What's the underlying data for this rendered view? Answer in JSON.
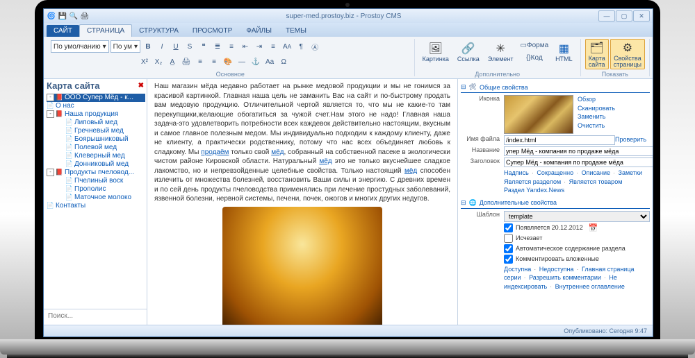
{
  "window": {
    "title": "super-med.prostoy.biz - Prostoy CMS",
    "min": "—",
    "max": "▢",
    "close": "✕"
  },
  "tabs": {
    "site": "САЙТ",
    "page": "СТРАНИЦА",
    "structure": "СТРУКТУРА",
    "view": "ПРОСМОТР",
    "files": "ФАЙЛЫ",
    "themes": "ТЕМЫ"
  },
  "ribbon": {
    "style_combo": "По умолчанию",
    "format_combo": "По ум",
    "group_main": "Основное",
    "group_extra": "Дополнительно",
    "group_show": "Показать",
    "picture": "Картинка",
    "link": "Ссылка",
    "element": "Элемент",
    "form": "Форма",
    "code": "Код",
    "html": "HTML",
    "sitemap": "Карта\nсайта",
    "pageprops": "Свойства\nстраницы"
  },
  "sidebar": {
    "title": "Карта сайта",
    "search_placeholder": "Поиск...",
    "items": [
      {
        "label": "ООО Супер Мёд - к...",
        "sel": true,
        "exp": "-",
        "icon": "📕"
      },
      {
        "label": "О нас",
        "icon": "📄"
      },
      {
        "label": "Наша продукция",
        "exp": "-",
        "icon": "📕",
        "children": [
          {
            "label": "Липовый мед"
          },
          {
            "label": "Гречневый мед"
          },
          {
            "label": "Боярышниковый"
          },
          {
            "label": "Полевой мед"
          },
          {
            "label": "Клеверный мед"
          },
          {
            "label": "Донниковый мед"
          }
        ]
      },
      {
        "label": "Продукты пчеловод...",
        "exp": "-",
        "icon": "📕",
        "children": [
          {
            "label": "Пчелиный воск"
          },
          {
            "label": "Прополис"
          },
          {
            "label": "Маточное молоко"
          }
        ]
      },
      {
        "label": "Контакты",
        "icon": "📄"
      }
    ]
  },
  "content": {
    "p1_a": "Наш магазин мёда недавно работает на рынке медовой продукции и мы не гонимся за красивой картинкой. Главная наша цель не заманить Вас на сайт и по-быстрому продать вам медовую продукцию. Отличительной чертой является то, что мы не какие-то там перекупщики,желающие обогатиться за чужой счет.Нам этого не надо! Главная наша задача-это удовлетворить потребности всех каждевок действительно настоящим, вкусным и самое главное полезным медом. Мы индивидуально подходим к каждому клиенту, даже не клиенту, а практически родственнику, потому что нас всех объединяет любовь к сладкому. Мы ",
    "p1_link1": "продаём",
    "p1_b": " только свой ",
    "p1_link2": "мёд",
    "p1_c": ", собранный на собственной пасеке в экологически чистом районе Кировской области. Натуральный ",
    "p1_link3": "мёд",
    "p1_d": " это не только вкуснейшее сладкое лакомство, но и непревзойденные целебные свойства. Только настоящий ",
    "p1_link4": "мёд",
    "p1_e": " способен излечить от множества болезней, восстановить Ваши силы и энергию. С древних времен и по сей день продукты пчеловодства применялись при лечение простудных заболеваний, язвенной болезни, нервной системы, печени, почек, ожогов и многих других недугов."
  },
  "props": {
    "section_common": "Общие свойства",
    "section_more": "Дополнительные свойства",
    "icon_label": "Иконка",
    "filename_label": "Имя файла",
    "filename_value": "/index.html",
    "name_label": "Название",
    "name_value": "упер Мёд - компания по продаже мёда",
    "title_label": "Заголовок",
    "title_value": "Супер Мёд - компания по продаже мёда",
    "review": "Обзор",
    "scan": "Сканировать",
    "replace": "Заменить",
    "clear": "Очистить",
    "check": "Проверить",
    "caption": "Надпись",
    "short": "Сокращенно",
    "descr": "Описание",
    "notes": "Заметки",
    "is_section": "Является разделом",
    "is_product": "Является товаром",
    "yandex": "Раздел Yandex.News",
    "template_label": "Шаблон",
    "template_value": "template",
    "appears": "Появляется 20.12.2012",
    "disappears": "Исчезает",
    "autocontent": "Автоматическое содержание раздела",
    "comment": "Комментировать вложенные",
    "avail": "Доступна",
    "unavail": "Недоступна",
    "main": "Главная страница",
    "series": "серии",
    "allowcomm": "Разрешить комментарии",
    "noindex": "Не индексировать",
    "internal": "Внутреннее оглавление"
  },
  "status": "Опубликовано: Сегодня 9:47"
}
